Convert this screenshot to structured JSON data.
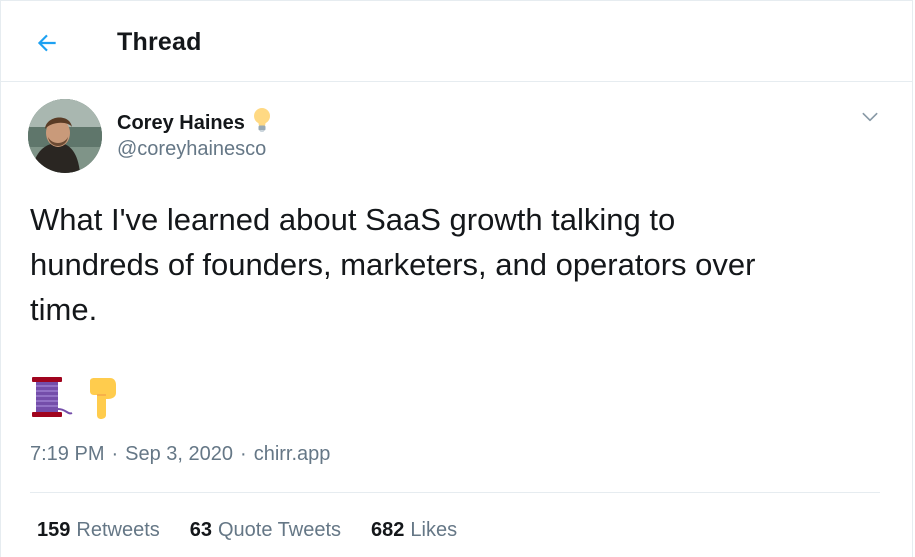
{
  "header": {
    "back_icon": "back-arrow-icon",
    "title": "Thread"
  },
  "tweet": {
    "author": {
      "name": "Corey Haines",
      "name_emoji_icon": "light-bulb-icon",
      "handle": "@coreyhainesco",
      "avatar": "profile-photo"
    },
    "menu_icon": "chevron-down-icon",
    "text": "What I've learned about SaaS growth talking to\nhundreds of founders, marketers, and operators over\ntime.",
    "emojis": [
      "thread-spool-icon",
      "pointing-down-icon"
    ],
    "meta": {
      "time": "7:19 PM",
      "separator": "·",
      "date": "Sep 3, 2020",
      "app": "chirr.app"
    },
    "stats": [
      {
        "count": "159",
        "label": "Retweets"
      },
      {
        "count": "63",
        "label": "Quote Tweets"
      },
      {
        "count": "682",
        "label": "Likes"
      }
    ]
  },
  "colors": {
    "accent": "#1da1f2",
    "text": "#14171a",
    "secondary": "#657786",
    "border": "#e6ecf0"
  }
}
